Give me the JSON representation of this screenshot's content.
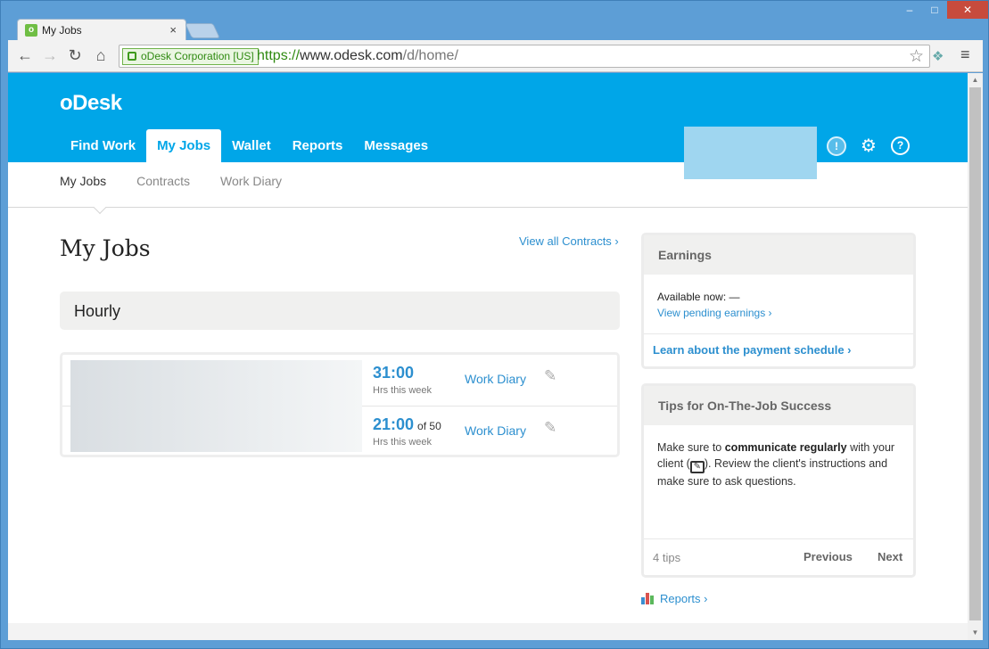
{
  "browser": {
    "tab_title": "My Jobs",
    "tab_close": "×",
    "window_controls": [
      "–",
      "□",
      "✕"
    ],
    "ev_label": "oDesk Corporation [US]",
    "url_scheme": "https://",
    "url_host": "www.odesk.com",
    "url_path": "/d/home/"
  },
  "header": {
    "logo": "oDesk",
    "nav": [
      "Find Work",
      "My Jobs",
      "Wallet",
      "Reports",
      "Messages"
    ],
    "active_nav": "My Jobs"
  },
  "subnav": {
    "items": [
      "My Jobs",
      "Contracts",
      "Work Diary"
    ],
    "active": "My Jobs"
  },
  "main": {
    "title": "My Jobs",
    "view_contracts": "View all Contracts ›",
    "section": "Hourly",
    "jobs": [
      {
        "hours": "31:00",
        "limit": "",
        "sub": "Hrs this week",
        "diary": "Work Diary"
      },
      {
        "hours": "21:00",
        "limit": "of 50",
        "sub": "Hrs this week",
        "diary": "Work Diary"
      }
    ]
  },
  "earnings": {
    "title": "Earnings",
    "available": "Available now: —",
    "pending_link": "View pending earnings ›",
    "schedule_link": "Learn about the payment schedule ›"
  },
  "tips": {
    "title": "Tips for On-The-Job Success",
    "text_1": "Make sure to ",
    "text_bold": "communicate regularly",
    "text_2": " with your client (",
    "text_3": "). Review the client's instructions and make sure to ask questions.",
    "count": "4 tips",
    "prev": "Previous",
    "next": "Next"
  },
  "reports_link": "Reports ›",
  "colors": {
    "brand": "#00a6e8",
    "link": "#2c8fcf"
  }
}
